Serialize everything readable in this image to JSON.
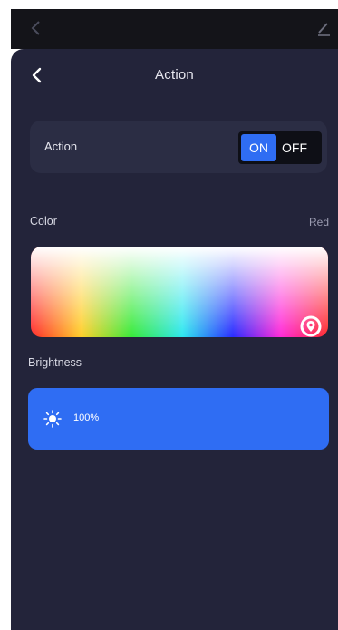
{
  "status_bar": {
    "back_icon": "chevron-left-icon",
    "edit_icon": "pen-icon"
  },
  "header": {
    "title": "Action",
    "back_icon": "chevron-left-icon"
  },
  "action_setting": {
    "label": "Action",
    "on_label": "ON",
    "off_label": "OFF",
    "selected": "ON"
  },
  "color_setting": {
    "label": "Color",
    "value": "Red",
    "picker_icon": "location-pin-icon"
  },
  "brightness_setting": {
    "label": "Brightness",
    "value": "100%",
    "level": 1.0,
    "icon": "sun-icon"
  },
  "colors": {
    "accent": "#2f6df3",
    "background": "#23243a",
    "card": "#2b2d44"
  }
}
